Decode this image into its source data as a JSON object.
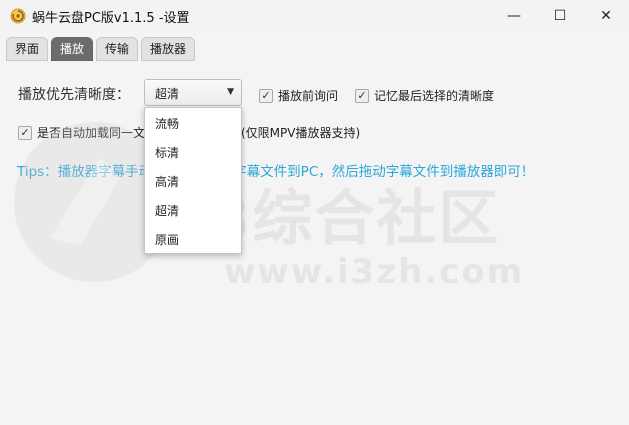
{
  "window": {
    "title": "蜗牛云盘PC版v1.1.5 -设置",
    "minimize_label": "—",
    "maximize_label": "☐",
    "close_label": "✕"
  },
  "tabs": [
    {
      "label": "界面"
    },
    {
      "label": "播放",
      "active": true
    },
    {
      "label": "传输"
    },
    {
      "label": "播放器"
    }
  ],
  "playback": {
    "resolution_label": "播放优先清晰度：",
    "resolution_selected": "超清",
    "resolution_options": [
      "流畅",
      "标清",
      "高清",
      "超清",
      "原画"
    ],
    "ask_before_play": {
      "label": "播放前询问",
      "checked": true
    },
    "remember_resolution": {
      "label": "记忆最后选择的清晰度",
      "checked": true
    },
    "auto_subtitle": {
      "label": "是否自动加载同一文件夹下的字幕文件(仅限MPV播放器支持)",
      "checked": true
    },
    "tips": "Tips：播放器字幕手动添加请先下载字幕文件到PC，然后拖动字幕文件到播放器即可！"
  },
  "watermark": {
    "brand": "i3综合社区",
    "url": "www.i3zh.com"
  },
  "colors": {
    "tips": "#2aa7d9",
    "active_tab": "#6c6c6c"
  }
}
